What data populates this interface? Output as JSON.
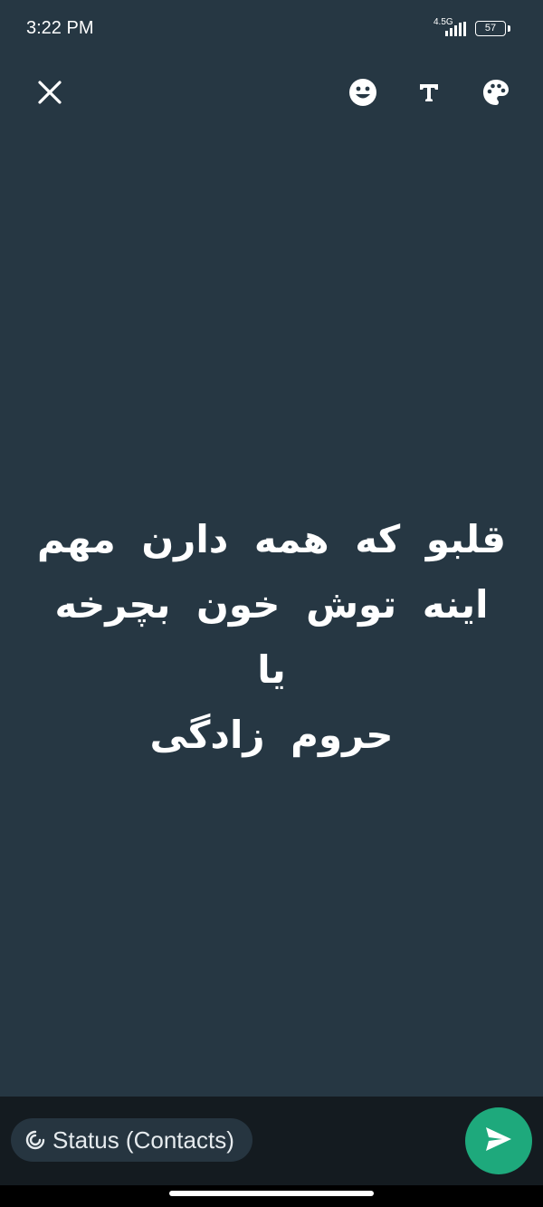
{
  "status_bar": {
    "time": "3:22 PM",
    "network_type": "4.5G",
    "battery_level": "57",
    "signal_icon": "signal-bars-icon"
  },
  "toolbar": {
    "close_icon": "close-icon",
    "emoji_icon": "emoji-icon",
    "text_style_icon": "text-style-icon",
    "palette_icon": "palette-icon"
  },
  "status_text": {
    "line1": "قلبو که همه دارن مهم",
    "line2": "اینه توش خون بچرخه یا",
    "line3": "حروم زادگی"
  },
  "bottom": {
    "audience_label": "Status (Contacts)",
    "audience_icon": "status-ring-icon",
    "send_icon": "send-icon"
  },
  "colors": {
    "background": "#263743",
    "bottom_bar": "#141b20",
    "chip": "#263540",
    "send_button": "#1ea97c"
  }
}
